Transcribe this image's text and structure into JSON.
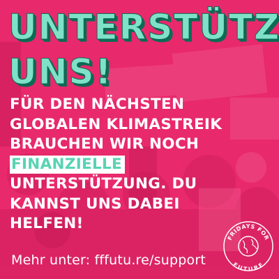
{
  "headline": {
    "line1": "UNTERSTÜTZ",
    "line2": "UNS!"
  },
  "body": {
    "line1": "FÜR DEN NÄCHSTEN",
    "line2": "GLOBALEN KLIMASTREIK",
    "line3": "BRAUCHEN WIR NOCH",
    "highlight": "FINANZIELLE",
    "line5": "UNTERSTÜTZUNG. DU",
    "line6": "KANNST UNS DABEI",
    "line7": "HELFEN!"
  },
  "footer": {
    "text": "Mehr unter: fffutu.re/support"
  },
  "logo": {
    "top_text": "FRIDAYS FOR",
    "bottom_text": "FUTURE"
  },
  "colors": {
    "background": "#e8296b",
    "headline": "#7fe2c8",
    "headline_shadow": "#0c6b55",
    "highlight_text": "#58d3b4",
    "text": "#ffffff"
  }
}
